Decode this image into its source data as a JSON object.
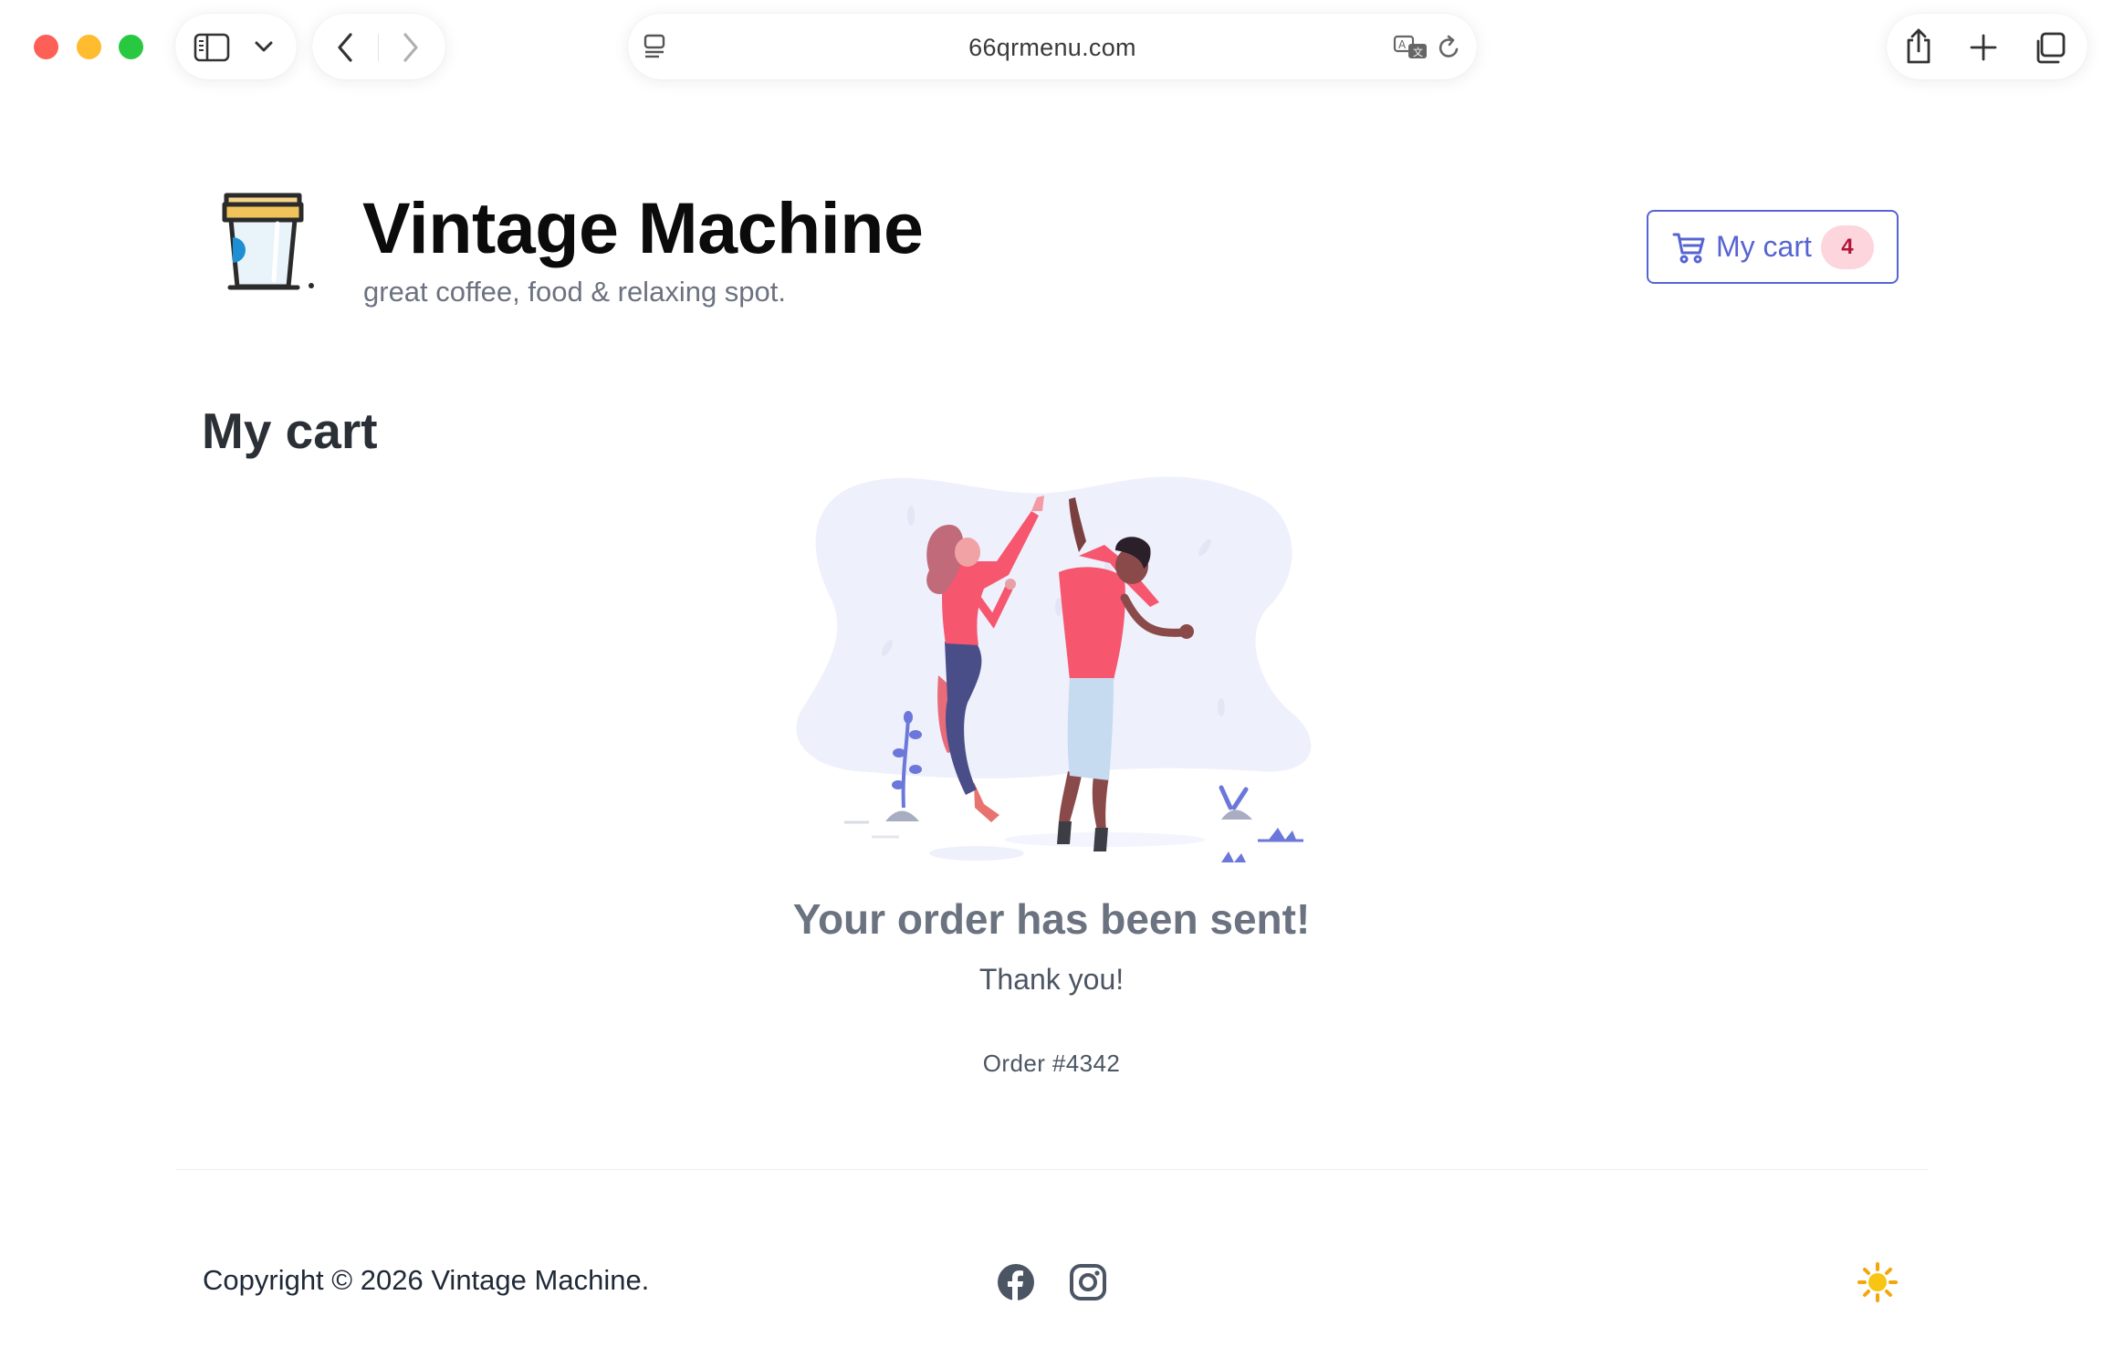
{
  "browser": {
    "url": "66qrmenu.com"
  },
  "brand": {
    "name": "Vintage Machine",
    "tagline": "great coffee, food & relaxing spot."
  },
  "header": {
    "cart_label": "My cart",
    "cart_count": "4"
  },
  "page": {
    "title": "My cart"
  },
  "confirmation": {
    "title": "Your order has been sent!",
    "subtitle": "Thank you!",
    "order_number": "Order #4342"
  },
  "footer": {
    "copyright": "Copyright © 2026 Vintage Machine.",
    "social": [
      "facebook-icon",
      "instagram-icon"
    ],
    "theme_icon": "sun-icon"
  },
  "colors": {
    "accent": "#5664d2",
    "badge_bg": "#fdd5dc",
    "badge_text": "#b4133a"
  }
}
